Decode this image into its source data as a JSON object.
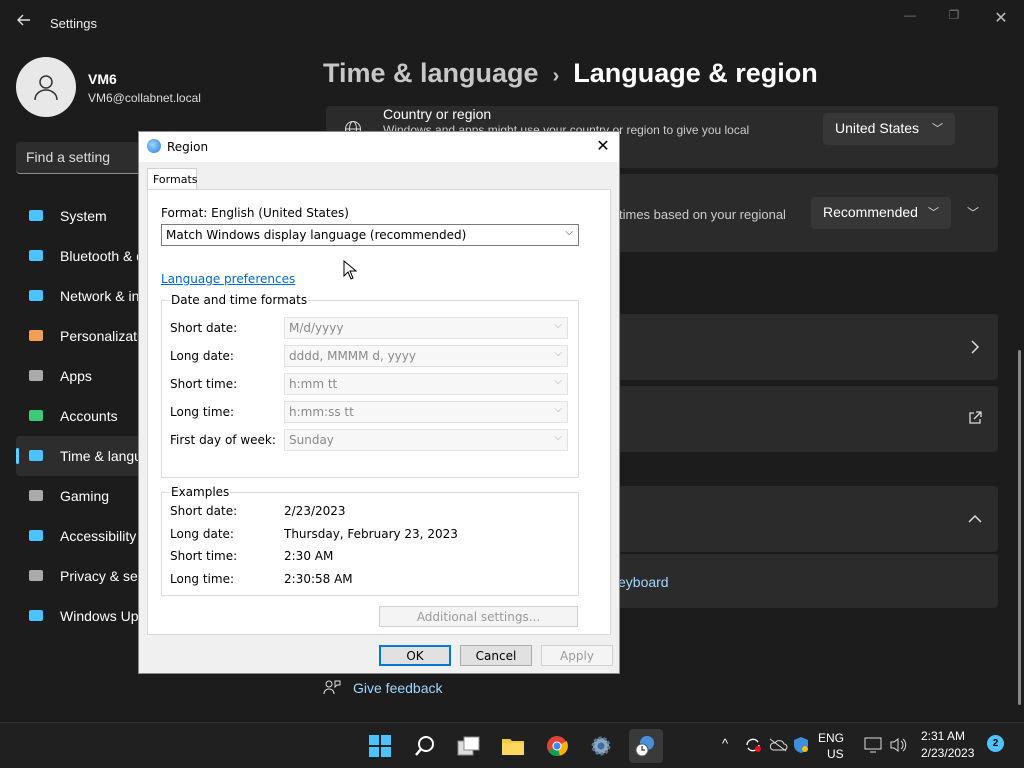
{
  "window": {
    "app_title": "Settings"
  },
  "profile": {
    "name": "VM6",
    "email": "VM6@collabnet.local"
  },
  "search": {
    "placeholder": "Find a setting"
  },
  "sidebar": {
    "items": [
      {
        "label": "System",
        "icon": "monitor-icon",
        "color": "#4cc2ff"
      },
      {
        "label": "Bluetooth & devices",
        "icon": "bluetooth-icon",
        "color": "#4cc2ff"
      },
      {
        "label": "Network & internet",
        "icon": "wifi-icon",
        "color": "#4cc2ff"
      },
      {
        "label": "Personalization",
        "icon": "paintbrush-icon",
        "color": "#f0a050"
      },
      {
        "label": "Apps",
        "icon": "apps-icon",
        "color": "#aaaaaa"
      },
      {
        "label": "Accounts",
        "icon": "person-icon",
        "color": "#3cc97a"
      },
      {
        "label": "Time & language",
        "icon": "clock-globe-icon",
        "color": "#4cc2ff",
        "active": true
      },
      {
        "label": "Gaming",
        "icon": "gamepad-icon",
        "color": "#aaaaaa"
      },
      {
        "label": "Accessibility",
        "icon": "accessibility-icon",
        "color": "#4cc2ff"
      },
      {
        "label": "Privacy & security",
        "icon": "shield-icon",
        "color": "#aaaaaa"
      },
      {
        "label": "Windows Update",
        "icon": "update-icon",
        "color": "#4cc2ff"
      }
    ]
  },
  "header": {
    "parent": "Time & language",
    "separator": "›",
    "current": "Language & region"
  },
  "main": {
    "country": {
      "title": "Country or region",
      "desc": "Windows and apps might use your country or region to give you local",
      "value": "United States"
    },
    "regional_format": {
      "desc": "times based on your regional",
      "value": "Recommended"
    },
    "keyboard_link": "eyboard",
    "feedback": "Give feedback"
  },
  "dialog": {
    "title": "Region",
    "tab": "Formats",
    "format_label": "Format: English (United States)",
    "format_value": "Match Windows display language (recommended)",
    "language_link": "Language preferences",
    "dt_group_title": "Date and time formats",
    "dt_rows": [
      {
        "label": "Short date:",
        "value": "M/d/yyyy"
      },
      {
        "label": "Long date:",
        "value": "dddd, MMMM d, yyyy"
      },
      {
        "label": "Short time:",
        "value": "h:mm tt"
      },
      {
        "label": "Long time:",
        "value": "h:mm:ss tt"
      },
      {
        "label": "First day of week:",
        "value": "Sunday"
      }
    ],
    "examples_title": "Examples",
    "examples": [
      {
        "label": "Short date:",
        "value": "2/23/2023"
      },
      {
        "label": "Long date:",
        "value": "Thursday, February 23, 2023"
      },
      {
        "label": "Short time:",
        "value": "2:30 AM"
      },
      {
        "label": "Long time:",
        "value": "2:30:58 AM"
      }
    ],
    "additional_settings": "Additional settings...",
    "ok": "OK",
    "cancel": "Cancel",
    "apply": "Apply"
  },
  "taskbar": {
    "lang_line1": "ENG",
    "lang_line2": "US",
    "time": "2:31 AM",
    "date": "2/23/2023",
    "notification_count": "2"
  }
}
